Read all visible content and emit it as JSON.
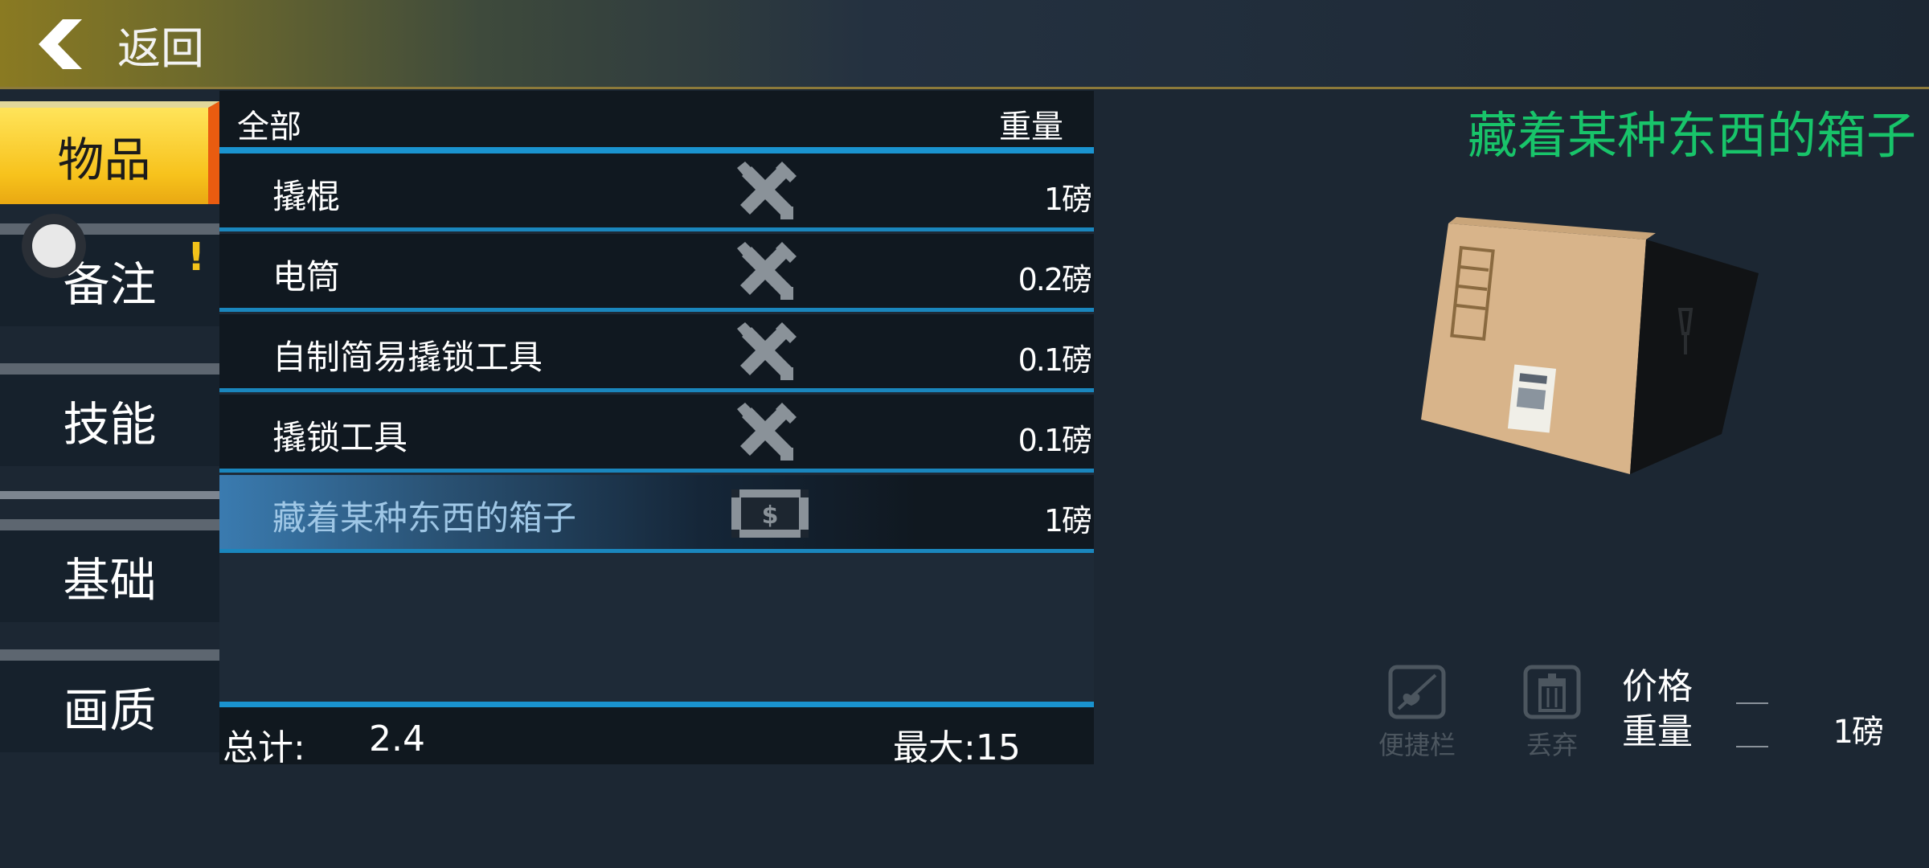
{
  "header": {
    "back_label": "返回"
  },
  "tabs": [
    {
      "label": "物品",
      "active": true
    },
    {
      "label": "备注",
      "alert": "!"
    },
    {
      "label": "技能"
    },
    {
      "label": "基础"
    },
    {
      "label": "画质"
    }
  ],
  "list": {
    "header_all": "全部",
    "header_weight": "重量",
    "rows": [
      {
        "name": "撬棍",
        "icon": "tools-icon",
        "weight": "1磅"
      },
      {
        "name": "电筒",
        "icon": "tools-icon",
        "weight": "0.2磅"
      },
      {
        "name": "自制简易撬锁工具",
        "icon": "tools-icon",
        "weight": "0.1磅"
      },
      {
        "name": "撬锁工具",
        "icon": "tools-icon",
        "weight": "0.1磅"
      },
      {
        "name": "藏着某种东西的箱子",
        "icon": "money-icon",
        "weight": "1磅",
        "selected": true
      }
    ],
    "footer": {
      "total_label": "总计:",
      "total_value": "2.4",
      "max_text": "最大:15"
    }
  },
  "detail": {
    "title": "藏着某种东西的箱子",
    "actions": [
      {
        "label": "便捷栏",
        "icon": "hotbar-icon"
      },
      {
        "label": "丢弃",
        "icon": "trash-icon"
      }
    ],
    "price_label": "价格",
    "weight_label": "重量",
    "weight_value": "1磅"
  },
  "colors": {
    "accent_blue": "#1a93cf",
    "active_tab": "#f7c21c",
    "title_green": "#18c46a"
  }
}
